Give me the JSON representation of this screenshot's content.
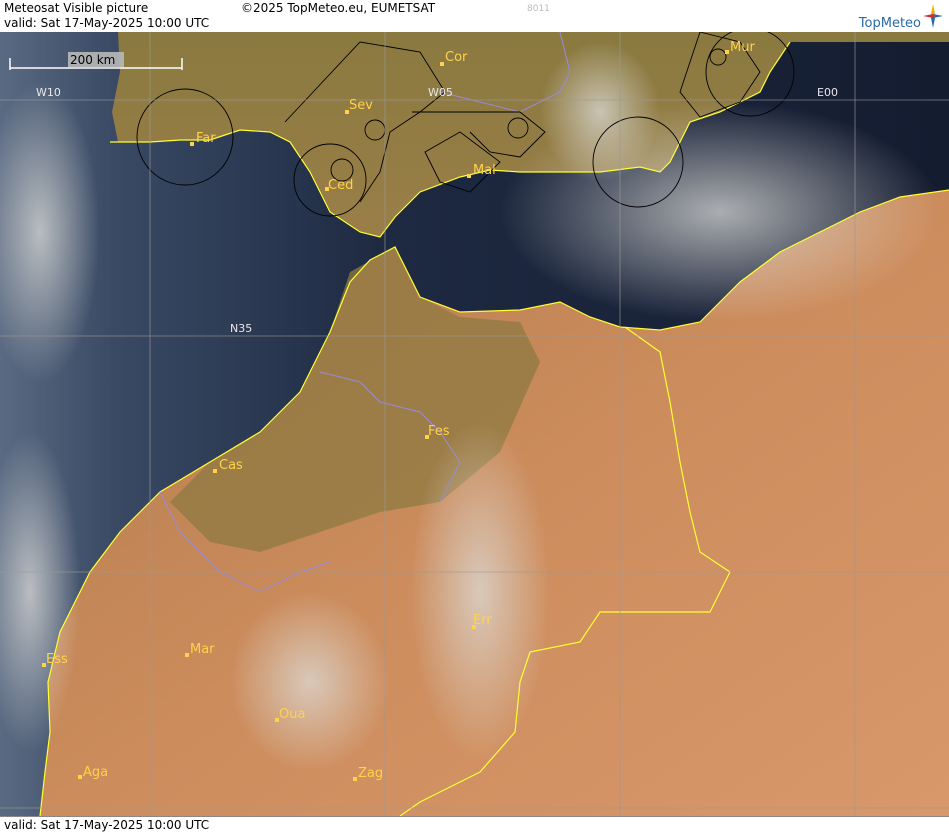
{
  "header": {
    "title": "Meteosat Visible picture",
    "copyright": "©2025 TopMeteo.eu, EUMETSAT",
    "valid": "valid:  Sat  17-May-2025  10:00 UTC",
    "code": "8011"
  },
  "logo": {
    "text": "TopMeteo"
  },
  "footer": {
    "valid": "valid:  Sat  17-May-2025  10:00 UTC"
  },
  "scale": {
    "label": "200 km"
  },
  "grid_labels": {
    "w10": "W10",
    "w05": "W05",
    "e00": "E00",
    "n35": "N35"
  },
  "cities": {
    "cor": "Cor",
    "mur": "Mur",
    "sev": "Sev",
    "far": "Far",
    "ced": "Ced",
    "mal": "Mal",
    "fes": "Fes",
    "cas": "Cas",
    "err": "Err",
    "ess": "Ess",
    "mar": "Mar",
    "oua": "Oua",
    "aga": "Aga",
    "zag": "Zag"
  },
  "colors": {
    "sea": "#1a2438",
    "land_north": "#8c7a3c",
    "land_desert": "#c98a5a",
    "coast": "#ffff33",
    "city_label": "#ffd24a",
    "grid": "#9a9a9a"
  }
}
